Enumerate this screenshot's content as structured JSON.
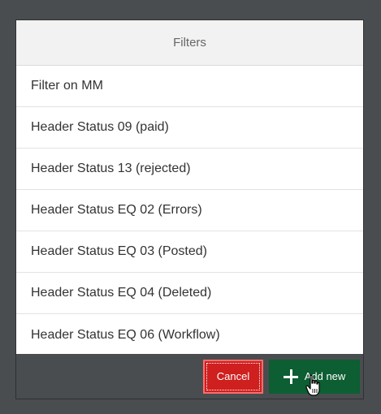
{
  "dialog": {
    "title": "Filters",
    "filters": [
      "Filter on MM",
      "Header Status 09 (paid)",
      "Header Status 13 (rejected)",
      "Header Status EQ 02 (Errors)",
      "Header Status EQ 03 (Posted)",
      "Header Status EQ 04 (Deleted)",
      "Header Status EQ 06 (Workflow)"
    ],
    "footer": {
      "cancel_label": "Cancel",
      "add_label": "Add new",
      "add_icon": "plus-icon",
      "cursor_icon": "hand-pointer-icon"
    }
  },
  "colors": {
    "backdrop": "#4a4d4f",
    "cancel": "#cf1f1f",
    "add_new": "#0d5e32",
    "header_bg": "#f2f2f2"
  }
}
